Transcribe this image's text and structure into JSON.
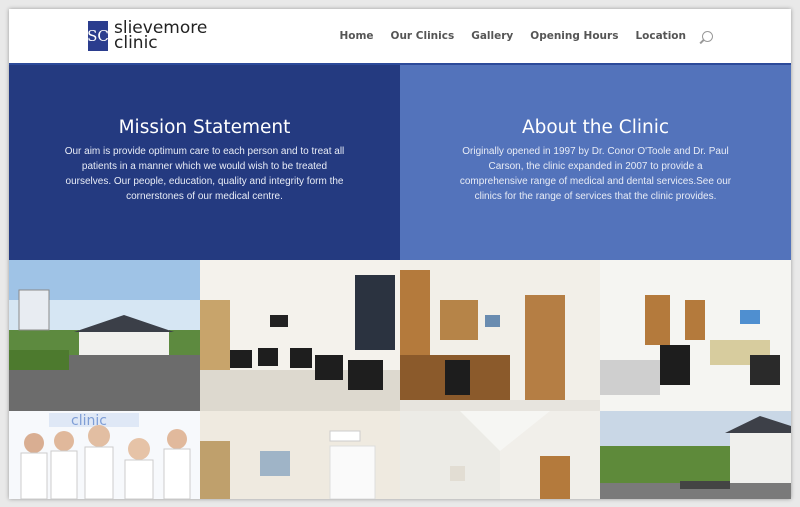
{
  "header": {
    "logo_line1": "slievemore",
    "logo_line2": "clinic",
    "logo_mark": "SC",
    "nav": [
      "Home",
      "Our Clinics",
      "Gallery",
      "Opening Hours",
      "Location"
    ]
  },
  "mission": {
    "title": "Mission Statement",
    "body": "Our aim is provide optimum care to each person and to treat all patients in a manner which we would wish to be treated ourselves. Our people, education, quality and integrity form the cornerstones of our medical centre."
  },
  "about": {
    "title": "About the Clinic",
    "body": "Originally opened in 1997 by Dr. Conor O'Toole and Dr. Paul Carson, the clinic expanded in 2007 to provide a comprehensive range of medical and dental services.See our clinics for the range of services that the clinic provides."
  },
  "gallery": {
    "staff_banner_text": "clinic"
  },
  "colors": {
    "mission_bg": "#243a80",
    "about_bg": "#5373bb",
    "brand": "#2b3d8e"
  }
}
